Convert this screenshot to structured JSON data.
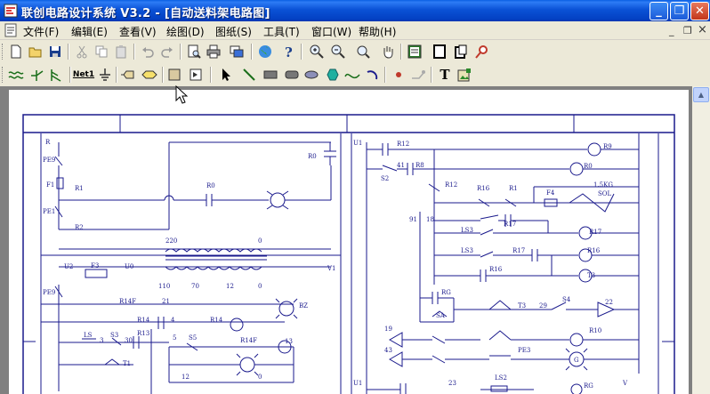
{
  "window": {
    "title": "联创电路设计系统 V3.2 - [自动送料架电路图]",
    "buttons": {
      "minimize": "_",
      "restore": "❐",
      "close": "✕"
    }
  },
  "menu": {
    "items": [
      "文件(F)",
      "编辑(E)",
      "查看(V)",
      "绘图(D)",
      "图纸(S)",
      "工具(T)",
      "窗口(W)",
      "帮助(H)"
    ],
    "mdi_minimize": "_",
    "mdi_restore": "❐",
    "mdi_close": "×"
  },
  "toolbar2": {
    "net_label": "Net1",
    "text_tool": "T"
  },
  "schematic": {
    "labels": {
      "R": "R",
      "PE9": "PE9",
      "F1": "F1",
      "R1": "R1",
      "PE1": "PE1",
      "R2": "R2",
      "R0": "R0",
      "R0b": "R0",
      "c220": "220",
      "c0": "0",
      "U1": "U1",
      "R12": "R12",
      "R9": "R9",
      "R0c": "R0",
      "S2": "S2",
      "n41": "41",
      "R8": "R8",
      "R12b": "R12",
      "R16": "R16",
      "R1b": "R1",
      "F4": "F4",
      "sol1": "1.5KG",
      "sol2": "SOL",
      "n91": "91",
      "n18": "18",
      "LS3": "LS3",
      "R17": "R17",
      "R17b": "R17",
      "LS3b": "LS3",
      "R17c": "R17",
      "R16b": "R16",
      "R16c": "R16",
      "T3": "T3",
      "U2": "U2",
      "F3": "F3",
      "U0": "U0",
      "V1": "V1",
      "n110": "110",
      "n70": "70",
      "n12": "12",
      "n0b": "0",
      "PE9b": "PE9",
      "R14F": "R14F",
      "n21": "21",
      "BZ": "BZ",
      "R14": "R14",
      "n4": "4",
      "R14b": "R14",
      "LS": "LS",
      "n3": "3",
      "S3": "S3",
      "n30": "30",
      "R13": "R13",
      "n5": "5",
      "S5": "S5",
      "R14F2": "R14F",
      "n13": "13",
      "T1": "T1",
      "n12b": "12",
      "n0c": "0",
      "RG": "RG",
      "SA": "SA",
      "T3b": "T3",
      "n29": "29",
      "S4": "S4",
      "n22": "22",
      "n19": "19",
      "R10": "R10",
      "n43": "43",
      "PE3": "PE3",
      "G": "G",
      "U1b": "U1",
      "n23": "23",
      "LS2": "LS2",
      "RG2": "RG",
      "V": "V"
    }
  }
}
